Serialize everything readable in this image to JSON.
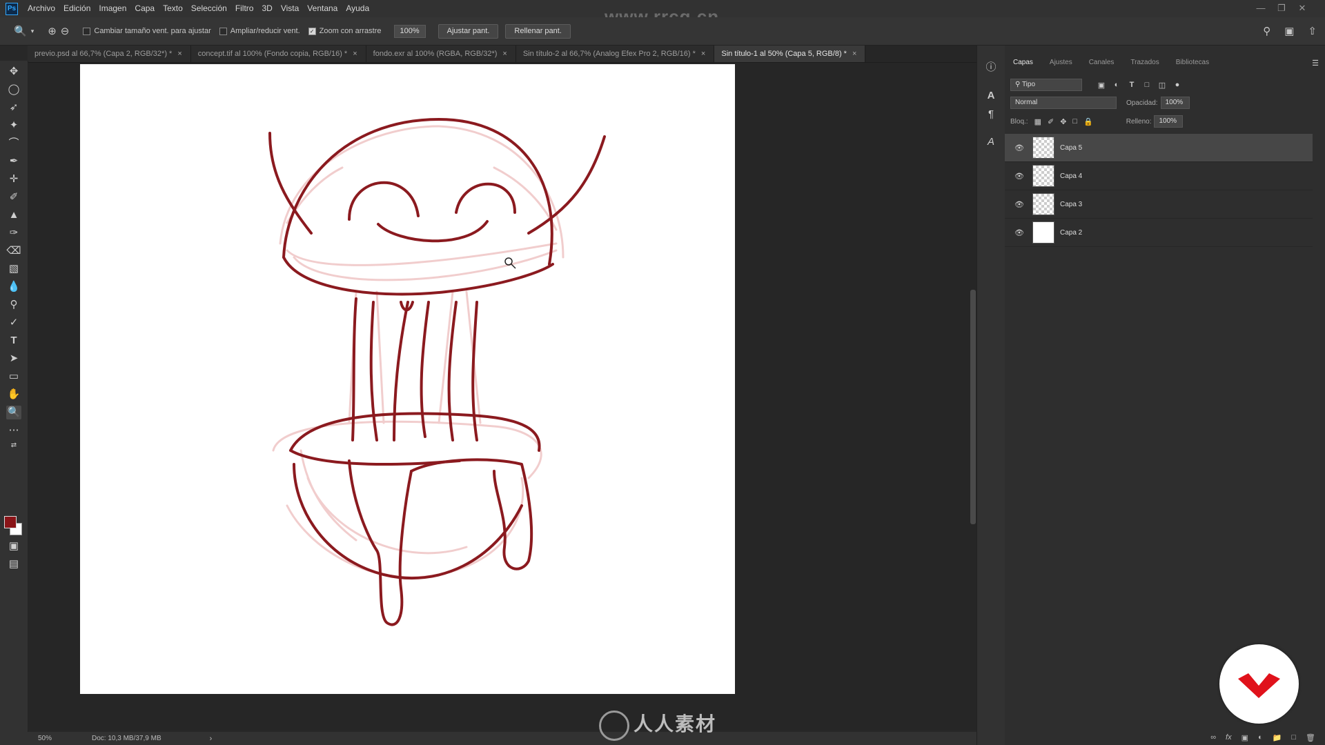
{
  "app": {
    "logo": "Ps"
  },
  "menu": [
    "Archivo",
    "Edición",
    "Imagen",
    "Capa",
    "Texto",
    "Selección",
    "Filtro",
    "3D",
    "Vista",
    "Ventana",
    "Ayuda"
  ],
  "watermark_top": "www.rrcg.cn",
  "options": {
    "resize_windows": "Cambiar tamaño vent. para ajustar",
    "zoom_all_windows": "Ampliar/reducir vent.",
    "scrubby_zoom": "Zoom con arrastre",
    "zoom_value": "100%",
    "fit_screen": "Ajustar pant.",
    "fill_screen": "Rellenar pant."
  },
  "tabs": [
    {
      "label": "previo.psd al 66,7% (Capa 2, RGB/32*) *",
      "active": false
    },
    {
      "label": "concept.tif al 100% (Fondo copia, RGB/16) *",
      "active": false
    },
    {
      "label": "fondo.exr al 100% (RGBA, RGB/32*)",
      "active": false
    },
    {
      "label": "Sin título-2 al 66,7% (Analog Efex Pro 2, RGB/16) *",
      "active": false
    },
    {
      "label": "Sin título-1 al 50% (Capa 5, RGB/8) *",
      "active": true
    }
  ],
  "status": {
    "zoom": "50%",
    "doc": "Doc: 10,3 MB/37,9 MB"
  },
  "colors": {
    "foreground": "#8a1418",
    "background": "#ffffff",
    "sketch_dark": "#8b1a1f",
    "sketch_light": "#f0c8c8"
  },
  "panel": {
    "tabs": [
      "Capas",
      "Ajustes",
      "Canales",
      "Trazados",
      "Bibliotecas"
    ],
    "filter": "Tipo",
    "blend_mode": "Normal",
    "opacity_label": "Opacidad:",
    "opacity_value": "100%",
    "lock_label": "Bloq.:",
    "fill_label": "Relleno:",
    "fill_value": "100%"
  },
  "layers": [
    {
      "name": "Capa 5",
      "selected": true,
      "thumb": "sketch"
    },
    {
      "name": "Capa 4",
      "selected": false,
      "thumb": "transparent"
    },
    {
      "name": "Capa 3",
      "selected": false,
      "thumb": "sketch"
    },
    {
      "name": "Capa 2",
      "selected": false,
      "thumb": "white"
    }
  ],
  "watermark_bottom": "人人素材"
}
